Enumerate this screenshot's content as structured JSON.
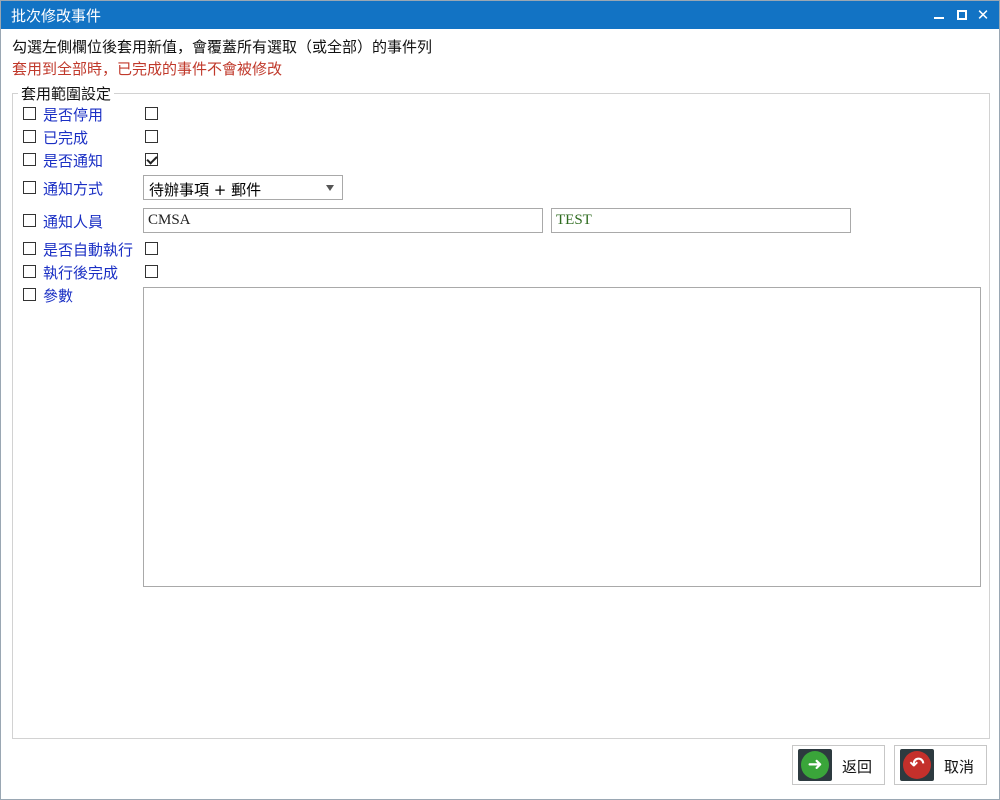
{
  "window": {
    "title": "批次修改事件",
    "controls": {
      "minimize_icon": "minimize-icon",
      "maximize_icon": "maximize-icon",
      "close_glyph": "✕"
    }
  },
  "info": {
    "line1": "勾選左側欄位後套用新值，會覆蓋所有選取（或全部）的事件列",
    "line2": "套用到全部時，已完成的事件不會被修改",
    "warning_color": "#c0392b"
  },
  "group": {
    "legend": "套用範圍設定",
    "fields": [
      {
        "label": "是否停用",
        "enabled": false,
        "value_checked": false
      },
      {
        "label": "已完成",
        "enabled": false,
        "value_checked": false
      },
      {
        "label": "是否通知",
        "enabled": false,
        "value_checked": true
      },
      {
        "label": "通知方式",
        "enabled": false,
        "value": "待辦事項 + 郵件"
      },
      {
        "label": "通知人員",
        "enabled": false,
        "value1": "CMSA",
        "value2": "TEST"
      },
      {
        "label": "是否自動執行",
        "enabled": false,
        "value_checked": false
      },
      {
        "label": "執行後完成",
        "enabled": false,
        "value_checked": false
      },
      {
        "label": "參數",
        "enabled": false,
        "value": ""
      }
    ]
  },
  "buttons": {
    "back": {
      "label": "返回",
      "icon": "forward-arrow-icon",
      "color": "#3aa53a"
    },
    "cancel": {
      "label": "取消",
      "icon": "undo-arrow-icon",
      "color": "#c4302b"
    }
  },
  "colors": {
    "titlebar": "#1273c4",
    "field_label": "#1a2fc4",
    "recipient2_text": "#2e6b1f"
  }
}
